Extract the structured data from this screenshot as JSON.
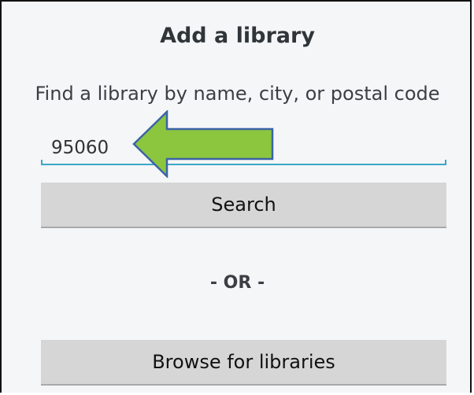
{
  "dialog": {
    "title": "Add a library",
    "prompt": "Find a library by name, city, or postal code"
  },
  "search": {
    "value": "95060"
  },
  "buttons": {
    "search_label": "Search",
    "browse_label": "Browse for libraries"
  },
  "separator": "- OR -",
  "colors": {
    "background": "#f5f6f7",
    "input_underline": "#3aa7c8",
    "button_bg": "#d6d6d6",
    "arrow_fill": "#8cc63f",
    "arrow_stroke": "#3b63a7"
  },
  "annotation": {
    "icon": "left-arrow-icon"
  }
}
